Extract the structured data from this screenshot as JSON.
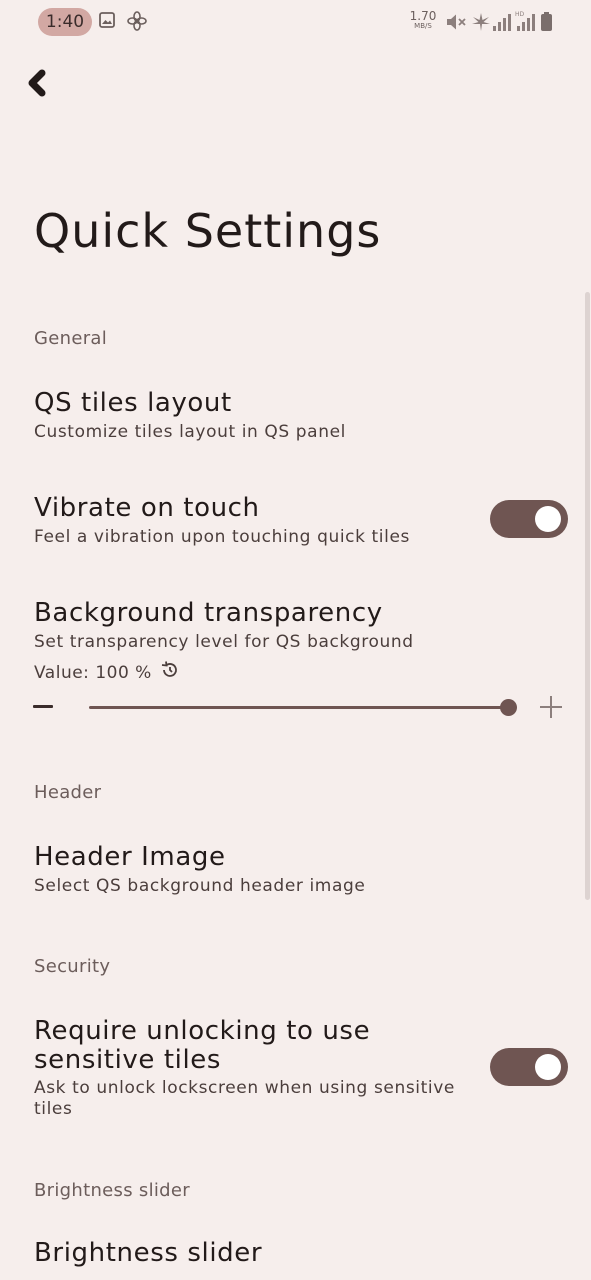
{
  "status_bar": {
    "time": "1:40",
    "net_speed_value": "1.70",
    "net_speed_unit": "MB/S",
    "icons": [
      "image-icon",
      "fan-icon",
      "mute-icon",
      "hotspot-icon",
      "signal-icon",
      "signal-hd-icon",
      "battery-icon"
    ]
  },
  "header": {
    "back_icon": "chevron-left-icon",
    "title": "Quick Settings"
  },
  "sections": {
    "general": "General",
    "header": "Header",
    "security": "Security",
    "brightness": "Brightness slider"
  },
  "prefs": {
    "qs_tiles_layout": {
      "title": "QS tiles layout",
      "summary": "Customize tiles layout in QS panel"
    },
    "vibrate_on_touch": {
      "title": "Vibrate on touch",
      "summary": "Feel a vibration upon touching quick tiles",
      "enabled": true
    },
    "background_transparency": {
      "title": "Background transparency",
      "summary": "Set transparency level for QS background",
      "value_label": "Value: 100 %",
      "value": 100,
      "min": 0,
      "max": 100,
      "reset_icon": "restore-icon"
    },
    "header_image": {
      "title": "Header Image",
      "summary": "Select QS background header image"
    },
    "require_unlock": {
      "title_line1": "Require unlocking to use",
      "title_line2": "sensitive tiles",
      "summary_line1": "Ask to unlock lockscreen when using sensitive",
      "summary_line2": "tiles",
      "enabled": true
    },
    "brightness_slider": {
      "title": "Brightness slider"
    }
  },
  "colors": {
    "background": "#f6eeec",
    "accent": "#6f5552",
    "time_pill": "#d2a8a3"
  }
}
